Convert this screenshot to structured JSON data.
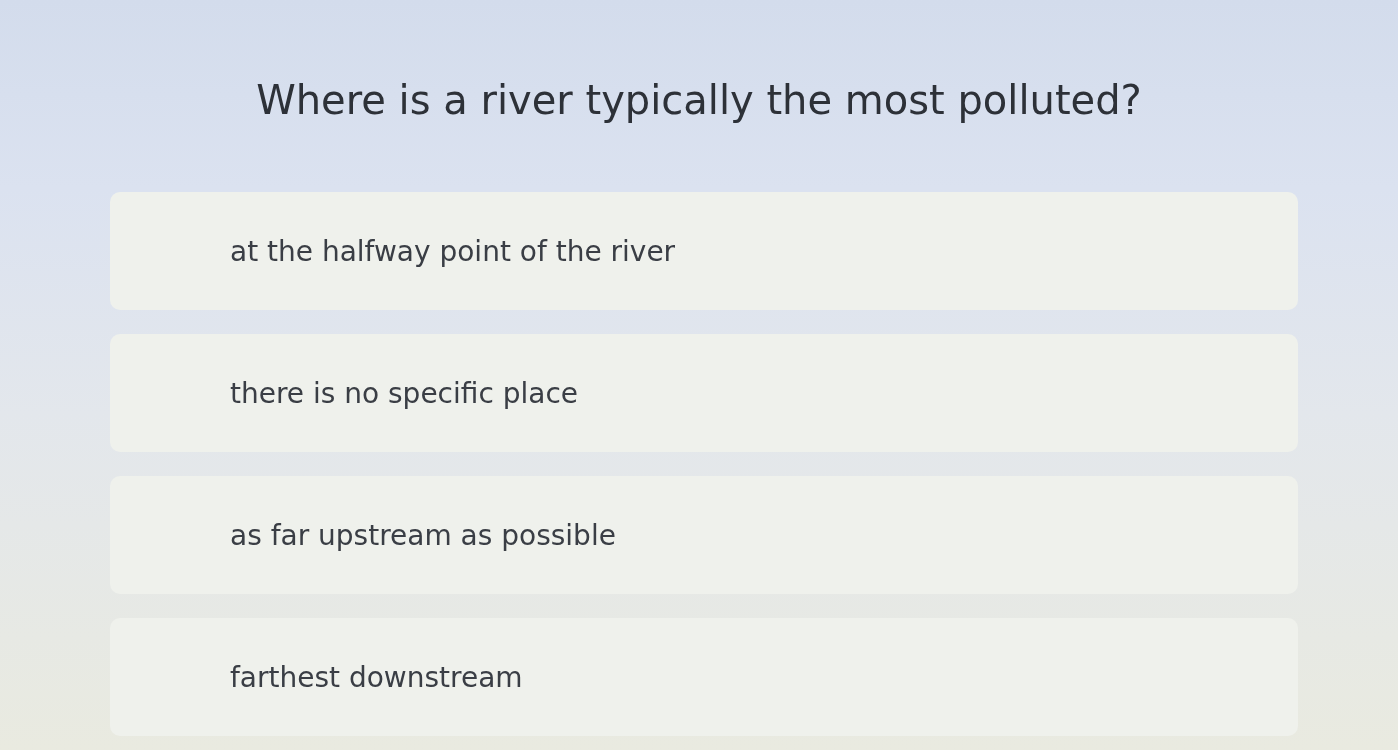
{
  "question": "Where is a river typically the most polluted?",
  "options": [
    {
      "label": "at the halfway point of the river",
      "selected": false
    },
    {
      "label": "there is no specific place",
      "selected": false
    },
    {
      "label": "as far upstream as possible",
      "selected": false
    },
    {
      "label": "farthest downstream",
      "selected": false
    }
  ]
}
